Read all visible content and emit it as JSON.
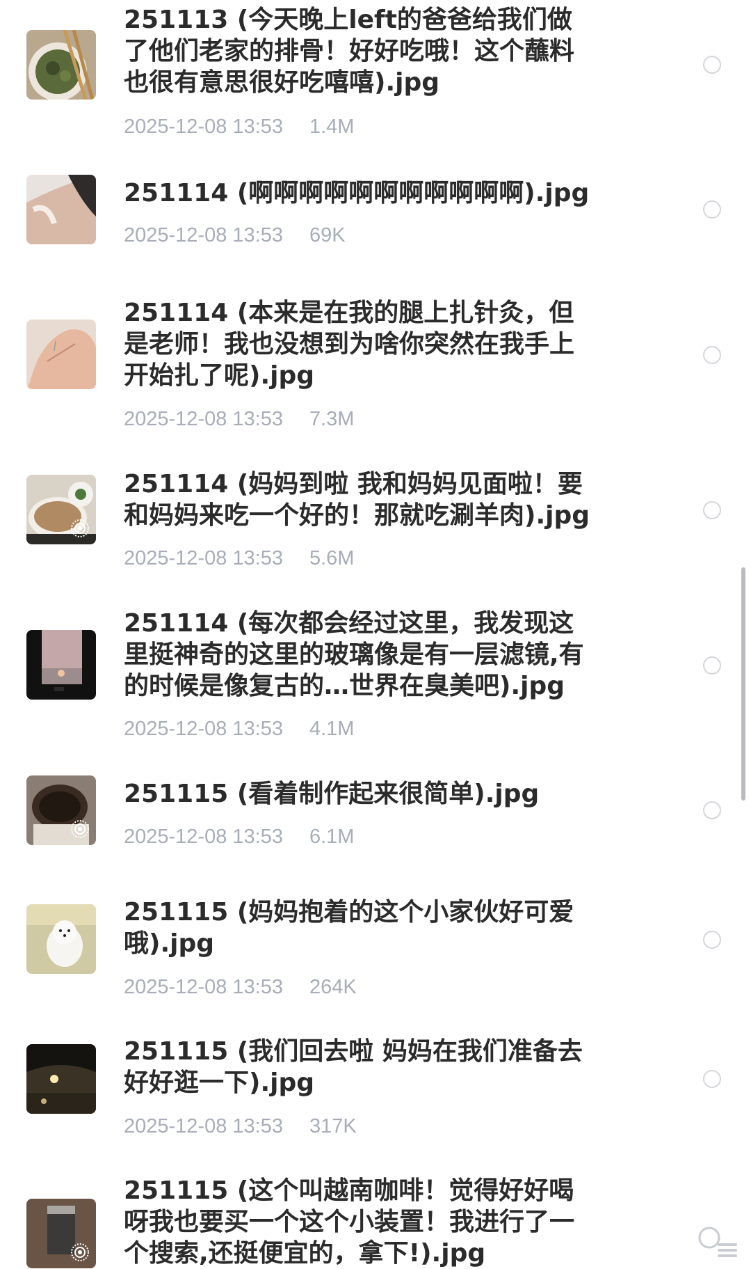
{
  "files": [
    {
      "name": "251113 (今天晚上left的爸爸给我们做了他们老家的排骨！好好吃哦！这个蘸料也很有意思很好吃嘻嘻).jpg",
      "date": "2025-12-08 13:53",
      "size": "1.4M",
      "thumb": "noodle-bowl-thumbnail",
      "live": false
    },
    {
      "name": "251114 (啊啊啊啊啊啊啊啊啊啊啊).jpg",
      "date": "2025-12-08 13:53",
      "size": "69K",
      "thumb": "leg-acupuncture-thumbnail",
      "live": false
    },
    {
      "name": "251114 (本来是在我的腿上扎针灸，但是老师！我也没想到为啥你突然在我手上开始扎了呢).jpg",
      "date": "2025-12-08 13:53",
      "size": "7.3M",
      "thumb": "hand-acupuncture-thumbnail",
      "live": false
    },
    {
      "name": "251114 (妈妈到啦 我和妈妈见面啦！要和妈妈来吃一个好的！那就吃涮羊肉).jpg",
      "date": "2025-12-08 13:53",
      "size": "5.6M",
      "thumb": "hotpot-thumbnail",
      "live": true
    },
    {
      "name": "251114 (每次都会经过这里，我发现这里挺神奇的这里的玻璃像是有一层滤镜,有的时候是像复古的…世界在臭美吧).jpg",
      "date": "2025-12-08 13:53",
      "size": "4.1M",
      "thumb": "window-sunset-thumbnail",
      "live": false
    },
    {
      "name": "251115 (看着制作起来很简单).jpg",
      "date": "2025-12-08 13:53",
      "size": "6.1M",
      "thumb": "coffee-pot-thumbnail",
      "live": true
    },
    {
      "name": "251115 (妈妈抱着的这个小家伙好可爱哦).jpg",
      "date": "2025-12-08 13:53",
      "size": "264K",
      "thumb": "puppy-thumbnail",
      "live": false
    },
    {
      "name": "251115 (我们回去啦 妈妈在我们准备去好好逛一下).jpg",
      "date": "2025-12-08 13:53",
      "size": "317K",
      "thumb": "night-car-thumbnail",
      "live": false
    },
    {
      "name": "251115 (这个叫越南咖啡！觉得好好喝呀我也要买一个这个小装置！我进行了一个搜索,还挺便宜的，拿下!).jpg",
      "date": "",
      "size": "",
      "thumb": "vietnamese-coffee-thumbnail",
      "live": true
    }
  ]
}
